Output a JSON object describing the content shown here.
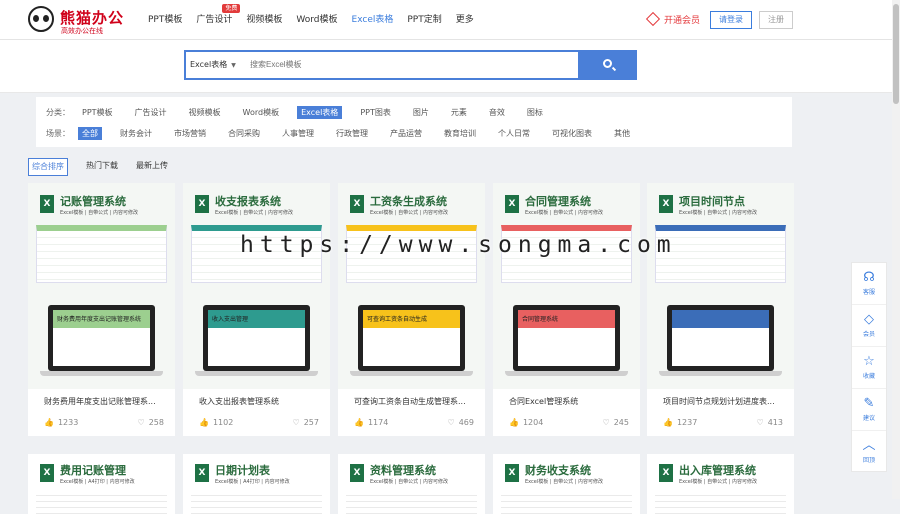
{
  "header": {
    "logo_name": "熊猫办公",
    "logo_slogan": "高效办公在线",
    "nav": [
      {
        "label": "PPT模板",
        "badge": ""
      },
      {
        "label": "广告设计",
        "badge": "免费"
      },
      {
        "label": "视频模板",
        "badge": ""
      },
      {
        "label": "Word模板",
        "badge": ""
      },
      {
        "label": "Excel表格",
        "badge": ""
      },
      {
        "label": "PPT定制",
        "badge": ""
      },
      {
        "label": "更多",
        "badge": ""
      }
    ],
    "active_nav": "Excel表格",
    "vip_label": "开通会员",
    "login_label": "请登录",
    "register_label": "注册"
  },
  "search": {
    "category": "Excel表格",
    "placeholder": "搜索Excel模板"
  },
  "filters": {
    "category_label": "分类：",
    "categories": [
      "PPT模板",
      "广告设计",
      "视频模板",
      "Word模板",
      "Excel表格",
      "PPT图表",
      "图片",
      "元素",
      "音效",
      "图标"
    ],
    "active_category": "Excel表格",
    "scene_label": "场景：",
    "scenes": [
      "全部",
      "财务会计",
      "市场营销",
      "合同采购",
      "人事管理",
      "行政管理",
      "产品运营",
      "教育培训",
      "个人日常",
      "可视化图表",
      "其他"
    ],
    "active_scene": "全部"
  },
  "sort": {
    "options": [
      "综合排序",
      "热门下载",
      "最新上传"
    ],
    "active": "综合排序"
  },
  "cards": [
    {
      "title": "记账管理系统",
      "subtitle": "Excel模板 | 自带公式 | 内容可修改",
      "name": "财务费用年度支出记账管理系...",
      "downloads": "1233",
      "likes": "258",
      "accent": "#9ccf8f",
      "screen_text": "财务费用年度支出记账管理系统"
    },
    {
      "title": "收支报表系统",
      "subtitle": "Excel模板 | 自带公式 | 内容可修改",
      "name": "收入支出报表管理系统",
      "downloads": "1102",
      "likes": "257",
      "accent": "#2e9b8f",
      "screen_text": "收入支出管理"
    },
    {
      "title": "工资条生成系统",
      "subtitle": "Excel模板 | 自带公式 | 内容可修改",
      "name": "可查询工资条自动生成管理系...",
      "downloads": "1174",
      "likes": "469",
      "accent": "#f7c21b",
      "screen_text": "可查询工资条自动生成"
    },
    {
      "title": "合同管理系统",
      "subtitle": "Excel模板 | 自带公式 | 内容可修改",
      "name": "合同Excel管理系统",
      "downloads": "1204",
      "likes": "245",
      "accent": "#e86060",
      "screen_text": "合同管理系统"
    },
    {
      "title": "项目时间节点",
      "subtitle": "Excel模板 | 自带公式 | 内容可修改",
      "name": "项目时间节点规划计划进度表...",
      "downloads": "1237",
      "likes": "413",
      "accent": "#3b6db8",
      "screen_text": ""
    }
  ],
  "cards_row2": [
    {
      "title": "费用记账管理",
      "subtitle": "Excel模板 | A4打印 | 内容可修改"
    },
    {
      "title": "日期计划表",
      "subtitle": "Excel模板 | A4打印 | 内容可修改"
    },
    {
      "title": "资料管理系统",
      "subtitle": "Excel模板 | 自带公式 | 内容可修改"
    },
    {
      "title": "财务收支系统",
      "subtitle": "Excel模板 | 自带公式 | 内容可修改"
    },
    {
      "title": "出入库管理系统",
      "subtitle": "Excel模板 | 自带公式 | 内容可修改"
    }
  ],
  "watermark": "https://www.songma.com",
  "sidebar": [
    {
      "label": "客服",
      "icon": "headset-icon"
    },
    {
      "label": "会员",
      "icon": "diamond-icon"
    },
    {
      "label": "收藏",
      "icon": "star-icon"
    },
    {
      "label": "建议",
      "icon": "edit-icon"
    },
    {
      "label": "回顶",
      "icon": "arrow-up-icon"
    }
  ]
}
